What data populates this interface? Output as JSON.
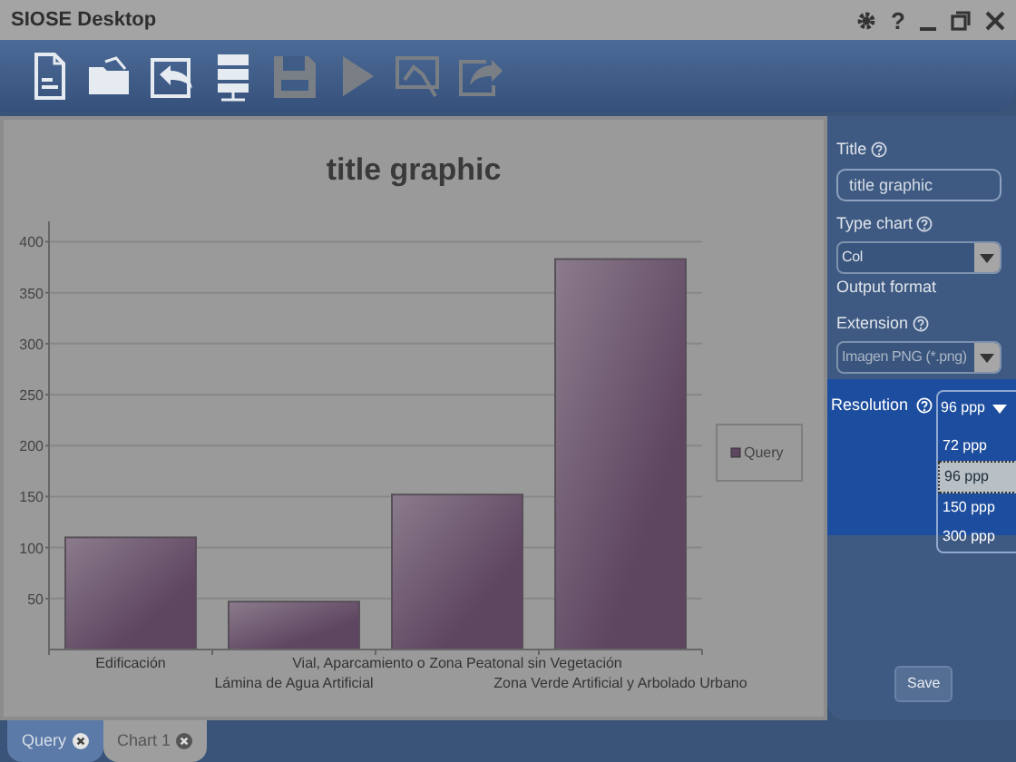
{
  "window": {
    "title": "SIOSE Desktop",
    "help_button": "?"
  },
  "toolbar": [
    {
      "kind": "new",
      "disabled": false
    },
    {
      "kind": "open",
      "disabled": false
    },
    {
      "kind": "import",
      "disabled": false
    },
    {
      "kind": "server",
      "disabled": false
    },
    {
      "kind": "save",
      "disabled": true
    },
    {
      "kind": "run",
      "disabled": true
    },
    {
      "kind": "chart",
      "disabled": true
    },
    {
      "kind": "export",
      "disabled": true
    }
  ],
  "chart": {
    "chart_data": {
      "type": "bar",
      "title": "title graphic",
      "categories": [
        "Edificación",
        "Lámina de Agua Artificial",
        "Vial, Aparcamiento o Zona Peatonal sin Vegetación",
        "Zona Verde Artificial y Arbolado Urbano"
      ],
      "series": [
        {
          "name": "Query",
          "color": "#5e4560",
          "values": [
            110,
            47,
            152,
            383
          ]
        }
      ],
      "ylim": [
        0,
        420
      ],
      "grid": true,
      "yticks": [
        50,
        100,
        150,
        200,
        250,
        300,
        350,
        400
      ]
    }
  },
  "settings": {
    "title_label": "Title",
    "title_value": "title graphic",
    "type_label": "Type chart",
    "type_value": "Col",
    "output_label": "Output format",
    "extension_label": "Extension",
    "extension_value": "Imagen PNG (*.png)",
    "resolution_label": "Resolution",
    "resolution_value": "96 ppp",
    "resolution_options": [
      {
        "label": "72 ppp",
        "selected": false
      },
      {
        "label": "96 ppp",
        "selected": true
      },
      {
        "label": "150 ppp",
        "selected": false
      },
      {
        "label": "300 ppp",
        "selected": false
      }
    ],
    "save_button": "Save"
  },
  "tabs": [
    {
      "label": "Query",
      "selected": false
    },
    {
      "label": "Chart 1",
      "selected": true
    }
  ]
}
